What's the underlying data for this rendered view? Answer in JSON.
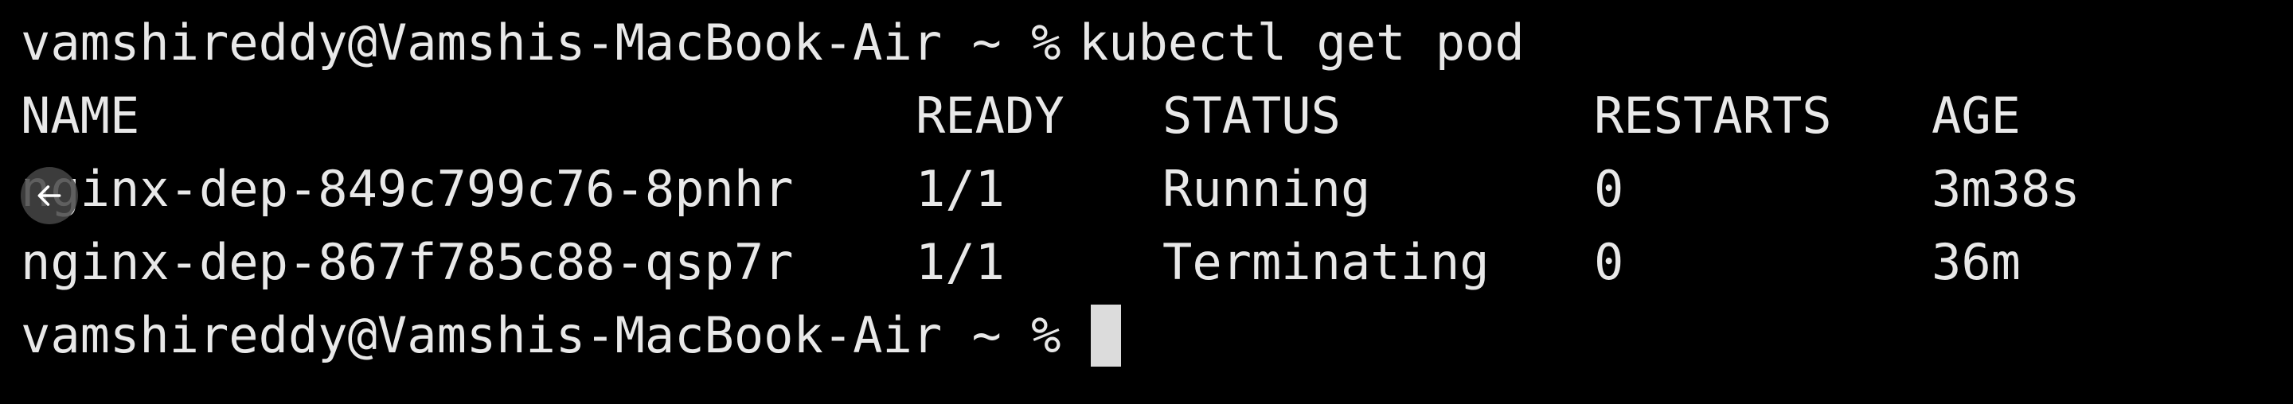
{
  "prompt": "vamshireddy@Vamshis-MacBook-Air ~ %",
  "command": "kubectl get pod",
  "headers": [
    "NAME",
    "READY",
    "STATUS",
    "RESTARTS",
    "AGE"
  ],
  "rows": [
    {
      "name": "nginx-dep-849c799c76-8pnhr",
      "ready": "1/1",
      "status": "Running",
      "restarts": "0",
      "age": "3m38s"
    },
    {
      "name": "nginx-dep-867f785c88-qsp7r",
      "ready": "1/1",
      "status": "Terminating",
      "restarts": "0",
      "age": "36m"
    }
  ],
  "overlay": {
    "icon": "back-arrow-icon"
  },
  "colors": {
    "background": "#000000",
    "text": "#e8e8e8"
  }
}
